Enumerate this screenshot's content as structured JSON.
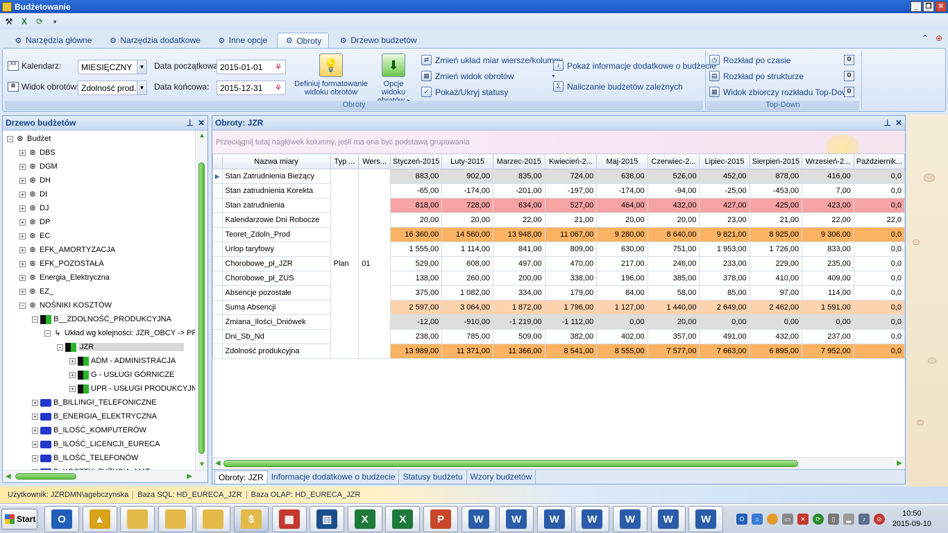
{
  "window": {
    "title": "Budżetowanie"
  },
  "ribbon_tabs": [
    {
      "label": "Narzędzia główne",
      "icon": "tools-icon"
    },
    {
      "label": "Narzędzia dodatkowe",
      "icon": "wrench-icon"
    },
    {
      "label": "Inne opcje",
      "icon": "gear-icon"
    },
    {
      "label": "Obroty",
      "icon": "coins-icon",
      "active": true
    },
    {
      "label": "Drzewo budżetów",
      "icon": "tree-icon"
    }
  ],
  "ribbon": {
    "kalendarz_label": "Kalendarz:",
    "kalendarz_value": "MIESIĘCZNY",
    "widok_label": "Widok obrotów:",
    "widok_value": "Zdolność prod.",
    "data_pocz_label": "Data początkowa:",
    "data_pocz_value": "2015-01-01",
    "data_konc_label": "Data końcowa:",
    "data_konc_value": "2015-12-31",
    "definiuj_label_1": "Definiuj formatowanie",
    "definiuj_label_2": "widoku obrotów",
    "opcje_label_1": "Opcje widoku",
    "opcje_label_2": "obrotów",
    "zmien_uklad": "Zmień układ miar wiersze/kolumny",
    "zmien_widok": "Zmień widok obrotów",
    "pokaz_statusy": "Pokaż/Ukryj statusy",
    "pokaz_info": "Pokaż informacje dodatkowe o budżecie",
    "naliczanie": "Naliczanie budżetów zależnych",
    "group_obroty": "Obroty",
    "rozklad_czas": "Rozkład po czasie",
    "rozklad_struktura": "Rozkład po strukturze",
    "widok_zbiorczy": "Widok zbiorczy rozkładu Top-Down",
    "group_topdown": "Top-Down"
  },
  "tree_panel": {
    "title": "Drzewo budżetów",
    "nodes": [
      {
        "label": "Budżet",
        "level": 0,
        "icon": "budget-icon",
        "expanded": true
      },
      {
        "label": "DBS",
        "level": 1,
        "icon": "budget-icon"
      },
      {
        "label": "DGM",
        "level": 1,
        "icon": "budget-icon"
      },
      {
        "label": "DH",
        "level": 1,
        "icon": "budget-icon"
      },
      {
        "label": "DI",
        "level": 1,
        "icon": "budget-icon"
      },
      {
        "label": "DJ",
        "level": 1,
        "icon": "budget-icon"
      },
      {
        "label": "DP",
        "level": 1,
        "icon": "budget-icon"
      },
      {
        "label": "EC",
        "level": 1,
        "icon": "budget-icon"
      },
      {
        "label": "EFK_AMORTYZACJA",
        "level": 1,
        "icon": "budget-icon"
      },
      {
        "label": "EFK_POZOSTAŁA",
        "level": 1,
        "icon": "budget-icon"
      },
      {
        "label": "Energia_Elektryczna",
        "level": 1,
        "icon": "budget-icon"
      },
      {
        "label": "EZ_",
        "level": 1,
        "icon": "budget-icon"
      },
      {
        "label": "NOŚNIKI KOSZTÓW",
        "level": 1,
        "icon": "budget-icon",
        "expanded": true
      },
      {
        "label": "B__ZDOLNOŚĆ_PRODUKCYJNA",
        "level": 2,
        "icon": "printer-green-icon",
        "expanded": true
      },
      {
        "label": "Układ wg kolejności: JZR_OBCY -> PRO",
        "level": 3,
        "icon": "hierarchy-icon",
        "expanded": true
      },
      {
        "label": "JZR",
        "level": 4,
        "icon": "printer-green-icon",
        "expanded": true,
        "selected": true
      },
      {
        "label": "ADM - ADMINISTRACJA",
        "level": 5,
        "icon": "printer-green-icon"
      },
      {
        "label": "G - USŁUGI GÓRNICZE",
        "level": 5,
        "icon": "printer-green-icon"
      },
      {
        "label": "UPR - USŁUGI PRODUKCYJNO-",
        "level": 5,
        "icon": "printer-green-icon"
      },
      {
        "label": "B_BILLINGI_TELEFONICZNE",
        "level": 2,
        "icon": "printer-blue-icon"
      },
      {
        "label": "B_ENERGIA_ELEKTRYCZNA",
        "level": 2,
        "icon": "printer-blue-icon"
      },
      {
        "label": "B_ILOŚĆ_KOMPUTERÓW",
        "level": 2,
        "icon": "printer-blue-icon"
      },
      {
        "label": "B_ILOŚĆ_LICENCJI_EURECA",
        "level": 2,
        "icon": "printer-blue-icon"
      },
      {
        "label": "B_ILOŚĆ_TELEFONÓW",
        "level": 2,
        "icon": "printer-blue-icon"
      },
      {
        "label": "B_KOSZTY_ZUŻYCIA_MAT",
        "level": 2,
        "icon": "printer-blue-icon"
      }
    ]
  },
  "grid_panel": {
    "title": "Obroty: JZR",
    "group_hint": "Przeciągnij tutaj nagłówek kolumny, jeśli ma ona być podstawą grupowania",
    "columns": [
      "Nazwa miary",
      "Typ ...",
      "Wers...",
      "Styczeń-2015",
      "Luty-2015",
      "Marzec-2015",
      "Kwiecień-2...",
      "Maj-2015",
      "Czerwiec-2...",
      "Lipiec-2015",
      "Sierpień-2015",
      "Wrzesień-2...",
      "Październik..."
    ],
    "typ_value": "Plan",
    "wersja_value": "01",
    "rows": [
      {
        "name": "Stan Zatrudnienia Bieżący",
        "style": "grey",
        "values": [
          "883,00",
          "902,00",
          "835,00",
          "724,00",
          "638,00",
          "526,00",
          "452,00",
          "878,00",
          "416,00",
          "0,0"
        ]
      },
      {
        "name": "Stan zatrudnienia Korekta",
        "style": "white",
        "values": [
          "-65,00",
          "-174,00",
          "-201,00",
          "-197,00",
          "-174,00",
          "-94,00",
          "-25,00",
          "-453,00",
          "7,00",
          "0,0"
        ]
      },
      {
        "name": "Stan zatrudnienia",
        "style": "red",
        "values": [
          "818,00",
          "728,00",
          "634,00",
          "527,00",
          "464,00",
          "432,00",
          "427,00",
          "425,00",
          "423,00",
          "0,0"
        ]
      },
      {
        "name": "Kalendarzowe Dni Robocze",
        "style": "white",
        "values": [
          "20,00",
          "20,00",
          "22,00",
          "21,00",
          "20,00",
          "20,00",
          "23,00",
          "21,00",
          "22,00",
          "22,0"
        ]
      },
      {
        "name": "Teoret_Zdoln_Prod",
        "style": "orange",
        "values": [
          "16 360,00",
          "14 560,00",
          "13 948,00",
          "11 067,00",
          "9 280,00",
          "8 640,00",
          "9 821,00",
          "8 925,00",
          "9 306,00",
          "0,0"
        ]
      },
      {
        "name": "Urlop taryfowy",
        "style": "white",
        "values": [
          "1 555,00",
          "1 114,00",
          "841,00",
          "809,00",
          "630,00",
          "751,00",
          "1 953,00",
          "1 726,00",
          "833,00",
          "0,0"
        ]
      },
      {
        "name": "Chorobowe_pł_JZR",
        "style": "white",
        "values": [
          "529,00",
          "608,00",
          "497,00",
          "470,00",
          "217,00",
          "246,00",
          "233,00",
          "229,00",
          "235,00",
          "0,0"
        ]
      },
      {
        "name": "Chorobowe_pł_ZUS",
        "style": "white",
        "values": [
          "138,00",
          "260,00",
          "200,00",
          "338,00",
          "196,00",
          "385,00",
          "378,00",
          "410,00",
          "409,00",
          "0,0"
        ]
      },
      {
        "name": "Absencje pozostałe",
        "style": "white",
        "values": [
          "375,00",
          "1 082,00",
          "334,00",
          "179,00",
          "84,00",
          "58,00",
          "85,00",
          "97,00",
          "114,00",
          "0,0"
        ]
      },
      {
        "name": "Suma Absencji",
        "style": "peach",
        "values": [
          "2 597,00",
          "3 064,00",
          "1 872,00",
          "1 796,00",
          "1 127,00",
          "1 440,00",
          "2 649,00",
          "2 462,00",
          "1 591,00",
          "0,0"
        ]
      },
      {
        "name": "Zmiana_Ilości_Dniówek",
        "style": "grey",
        "values": [
          "-12,00",
          "-910,00",
          "-1 219,00",
          "-1 112,00",
          "0,00",
          "20,00",
          "0,00",
          "0,00",
          "0,00",
          "0,0"
        ]
      },
      {
        "name": "Dni_Sb_Nd",
        "style": "white",
        "values": [
          "238,00",
          "785,00",
          "509,00",
          "382,00",
          "402,00",
          "357,00",
          "491,00",
          "432,00",
          "237,00",
          "0,0"
        ]
      },
      {
        "name": "Zdolność produkcyjna",
        "style": "orange",
        "values": [
          "13 989,00",
          "11 371,00",
          "11 366,00",
          "8 541,00",
          "8 555,00",
          "7 577,00",
          "7 663,00",
          "6 895,00",
          "7 952,00",
          "0,0"
        ]
      }
    ],
    "bottom_tabs": [
      "Obroty: JZR",
      "Informacje dodatkowe o budżecie",
      "Statusy budżetu",
      "Wzory budżetów"
    ]
  },
  "status_bar": {
    "user": "Użytkownik: JZRDMN\\agebczynska",
    "sql": "Baza SQL: HD_EURECA_JZR",
    "olap": "Baza OLAP: HD_EURECA_JZR"
  },
  "taskbar": {
    "start_label": "Start",
    "apps": [
      {
        "name": "outlook-icon",
        "glyph": "O",
        "color": "#1f5fb8"
      },
      {
        "name": "dynamics-icon",
        "glyph": "▲",
        "color": "#d9a21b"
      },
      {
        "name": "folder-icon",
        "glyph": "",
        "color": "#e3b94a"
      },
      {
        "name": "folder-icon",
        "glyph": "",
        "color": "#e3b94a"
      },
      {
        "name": "folder-icon",
        "glyph": "",
        "color": "#e3b94a"
      },
      {
        "name": "budget-app-icon",
        "glyph": "$",
        "color": "#e3b94a",
        "active": true
      },
      {
        "name": "flags-icon",
        "glyph": "▦",
        "color": "#c4382e"
      },
      {
        "name": "books-icon",
        "glyph": "▥",
        "color": "#1b4f8c"
      },
      {
        "name": "excel-icon",
        "glyph": "X",
        "color": "#1e7a3c"
      },
      {
        "name": "excel-icon",
        "glyph": "X",
        "color": "#1e7a3c"
      },
      {
        "name": "powerpoint-icon",
        "glyph": "P",
        "color": "#c8472b"
      },
      {
        "name": "word-icon",
        "glyph": "W",
        "color": "#2a5caa"
      },
      {
        "name": "word-icon",
        "glyph": "W",
        "color": "#2a5caa"
      },
      {
        "name": "word-icon",
        "glyph": "W",
        "color": "#2a5caa"
      },
      {
        "name": "word-icon",
        "glyph": "W",
        "color": "#2a5caa"
      },
      {
        "name": "word-icon",
        "glyph": "W",
        "color": "#2a5caa"
      },
      {
        "name": "word-icon",
        "glyph": "W",
        "color": "#2a5caa"
      },
      {
        "name": "word-icon",
        "glyph": "W",
        "color": "#2a5caa"
      }
    ],
    "time": "10:50",
    "date": "2015-09-10"
  },
  "colors": {
    "grey": "#dedede",
    "white": "#ffffff",
    "red": "#f6a3a3",
    "orange": "#fbb262",
    "peach": "#fdd3ae"
  }
}
